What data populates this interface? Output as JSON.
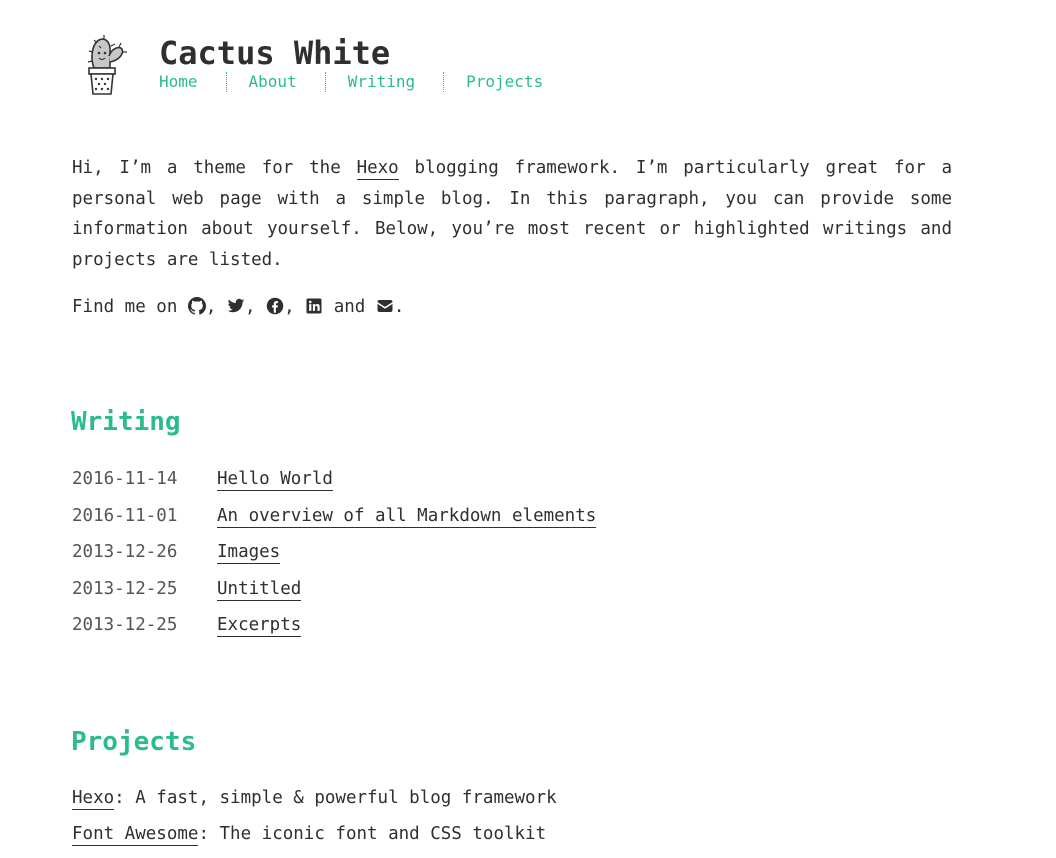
{
  "header": {
    "title": "Cactus White",
    "logo_icon": "cactus-logo-icon",
    "nav": [
      {
        "label": "Home"
      },
      {
        "label": "About"
      },
      {
        "label": "Writing"
      },
      {
        "label": "Projects"
      }
    ]
  },
  "intro": {
    "before_link": "Hi, I’m a theme for the ",
    "link": "Hexo",
    "after_link": " blogging framework. I’m particularly great for a personal web page with a simple blog. In this paragraph, you can provide some information about yourself. Below, you’re most recent or highlighted writings and projects are listed."
  },
  "find_me": {
    "prefix": "Find me on ",
    "sep1": ",",
    "sep2": ",",
    "sep3": ",",
    "and": "and",
    "suffix": ".",
    "icons": [
      "github-icon",
      "twitter-icon",
      "facebook-icon",
      "linkedin-icon",
      "envelope-icon"
    ]
  },
  "writing": {
    "title": "Writing",
    "posts": [
      {
        "date": "2016-11-14",
        "title": "Hello World"
      },
      {
        "date": "2016-11-01",
        "title": "An overview of all Markdown elements"
      },
      {
        "date": "2013-12-26",
        "title": "Images"
      },
      {
        "date": "2013-12-25",
        "title": "Untitled"
      },
      {
        "date": "2013-12-25",
        "title": "Excerpts"
      }
    ]
  },
  "projects": {
    "title": "Projects",
    "items": [
      {
        "name": "Hexo",
        "description": ": A fast, simple & powerful blog framework"
      },
      {
        "name": "Font Awesome",
        "description": ": The iconic font and CSS toolkit"
      }
    ]
  },
  "colors": {
    "accent": "#2bbc8a",
    "text": "#2f2f2f",
    "background": "#ffffff"
  }
}
